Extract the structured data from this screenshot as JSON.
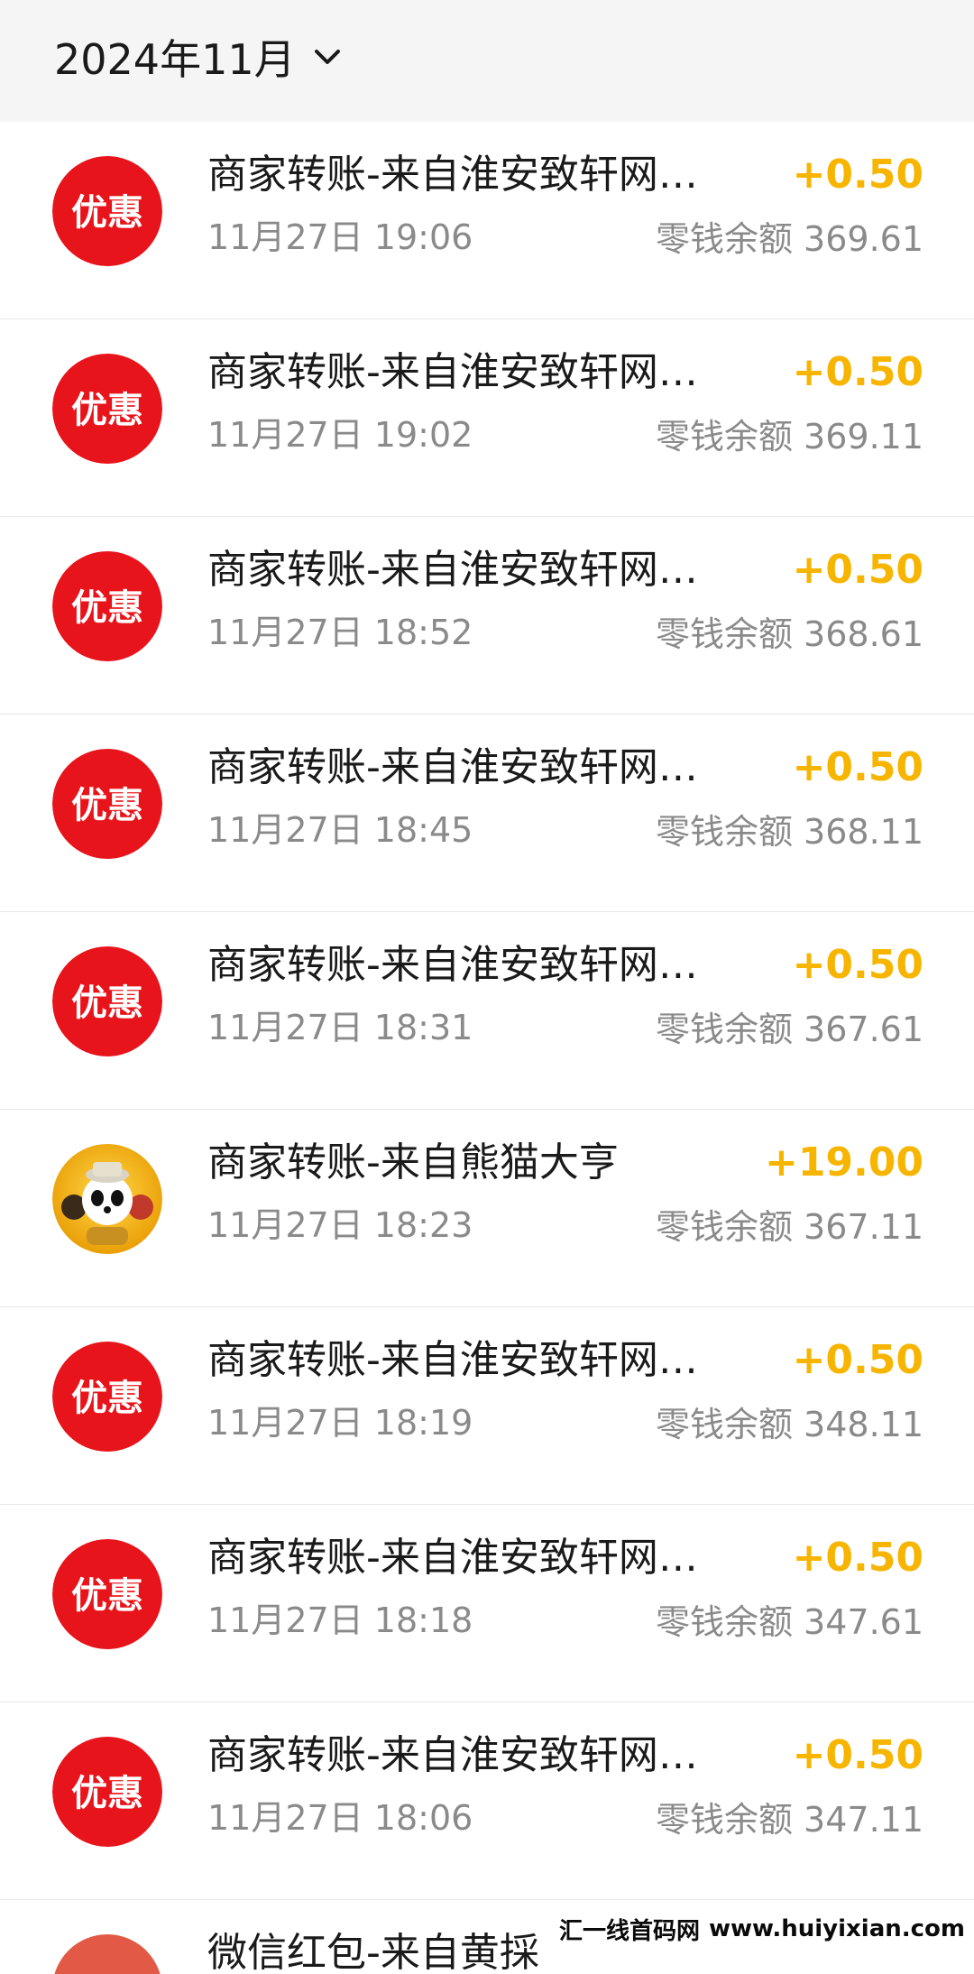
{
  "header": {
    "month_label": "2024年11月",
    "chevron_icon": "chevron-down-icon"
  },
  "colors": {
    "amount": "#f7b500",
    "badge_red": "#e8141b",
    "secondary_text": "#8a8a8a",
    "header_bg": "#f5f5f5"
  },
  "transactions": [
    {
      "title": "商家转账-来自淮安致轩网…",
      "time": "11月27日 19:06",
      "amount": "+0.50",
      "balance": "零钱余额 369.61",
      "avatar": "discount-badge-icon",
      "avatar_text": "优惠"
    },
    {
      "title": "商家转账-来自淮安致轩网…",
      "time": "11月27日 19:02",
      "amount": "+0.50",
      "balance": "零钱余额 369.11",
      "avatar": "discount-badge-icon",
      "avatar_text": "优惠"
    },
    {
      "title": "商家转账-来自淮安致轩网…",
      "time": "11月27日 18:52",
      "amount": "+0.50",
      "balance": "零钱余额 368.61",
      "avatar": "discount-badge-icon",
      "avatar_text": "优惠"
    },
    {
      "title": "商家转账-来自淮安致轩网…",
      "time": "11月27日 18:45",
      "amount": "+0.50",
      "balance": "零钱余额 368.11",
      "avatar": "discount-badge-icon",
      "avatar_text": "优惠"
    },
    {
      "title": "商家转账-来自淮安致轩网…",
      "time": "11月27日 18:31",
      "amount": "+0.50",
      "balance": "零钱余额 367.61",
      "avatar": "discount-badge-icon",
      "avatar_text": "优惠"
    },
    {
      "title": "商家转账-来自熊猫大亨",
      "time": "11月27日 18:23",
      "amount": "+19.00",
      "balance": "零钱余额 367.11",
      "avatar": "panda-tycoon-avatar-icon",
      "avatar_text": ""
    },
    {
      "title": "商家转账-来自淮安致轩网…",
      "time": "11月27日 18:19",
      "amount": "+0.50",
      "balance": "零钱余额 348.11",
      "avatar": "discount-badge-icon",
      "avatar_text": "优惠"
    },
    {
      "title": "商家转账-来自淮安致轩网…",
      "time": "11月27日 18:18",
      "amount": "+0.50",
      "balance": "零钱余额 347.61",
      "avatar": "discount-badge-icon",
      "avatar_text": "优惠"
    },
    {
      "title": "商家转账-来自淮安致轩网…",
      "time": "11月27日 18:06",
      "amount": "+0.50",
      "balance": "零钱余额 347.11",
      "avatar": "discount-badge-icon",
      "avatar_text": "优惠"
    }
  ],
  "partial_transaction": {
    "title": "微信红包-来自黄採",
    "avatar": "red-packet-avatar-icon"
  },
  "watermark": {
    "cn": "汇一线首码网",
    "en": "www.huiyixian.com"
  }
}
